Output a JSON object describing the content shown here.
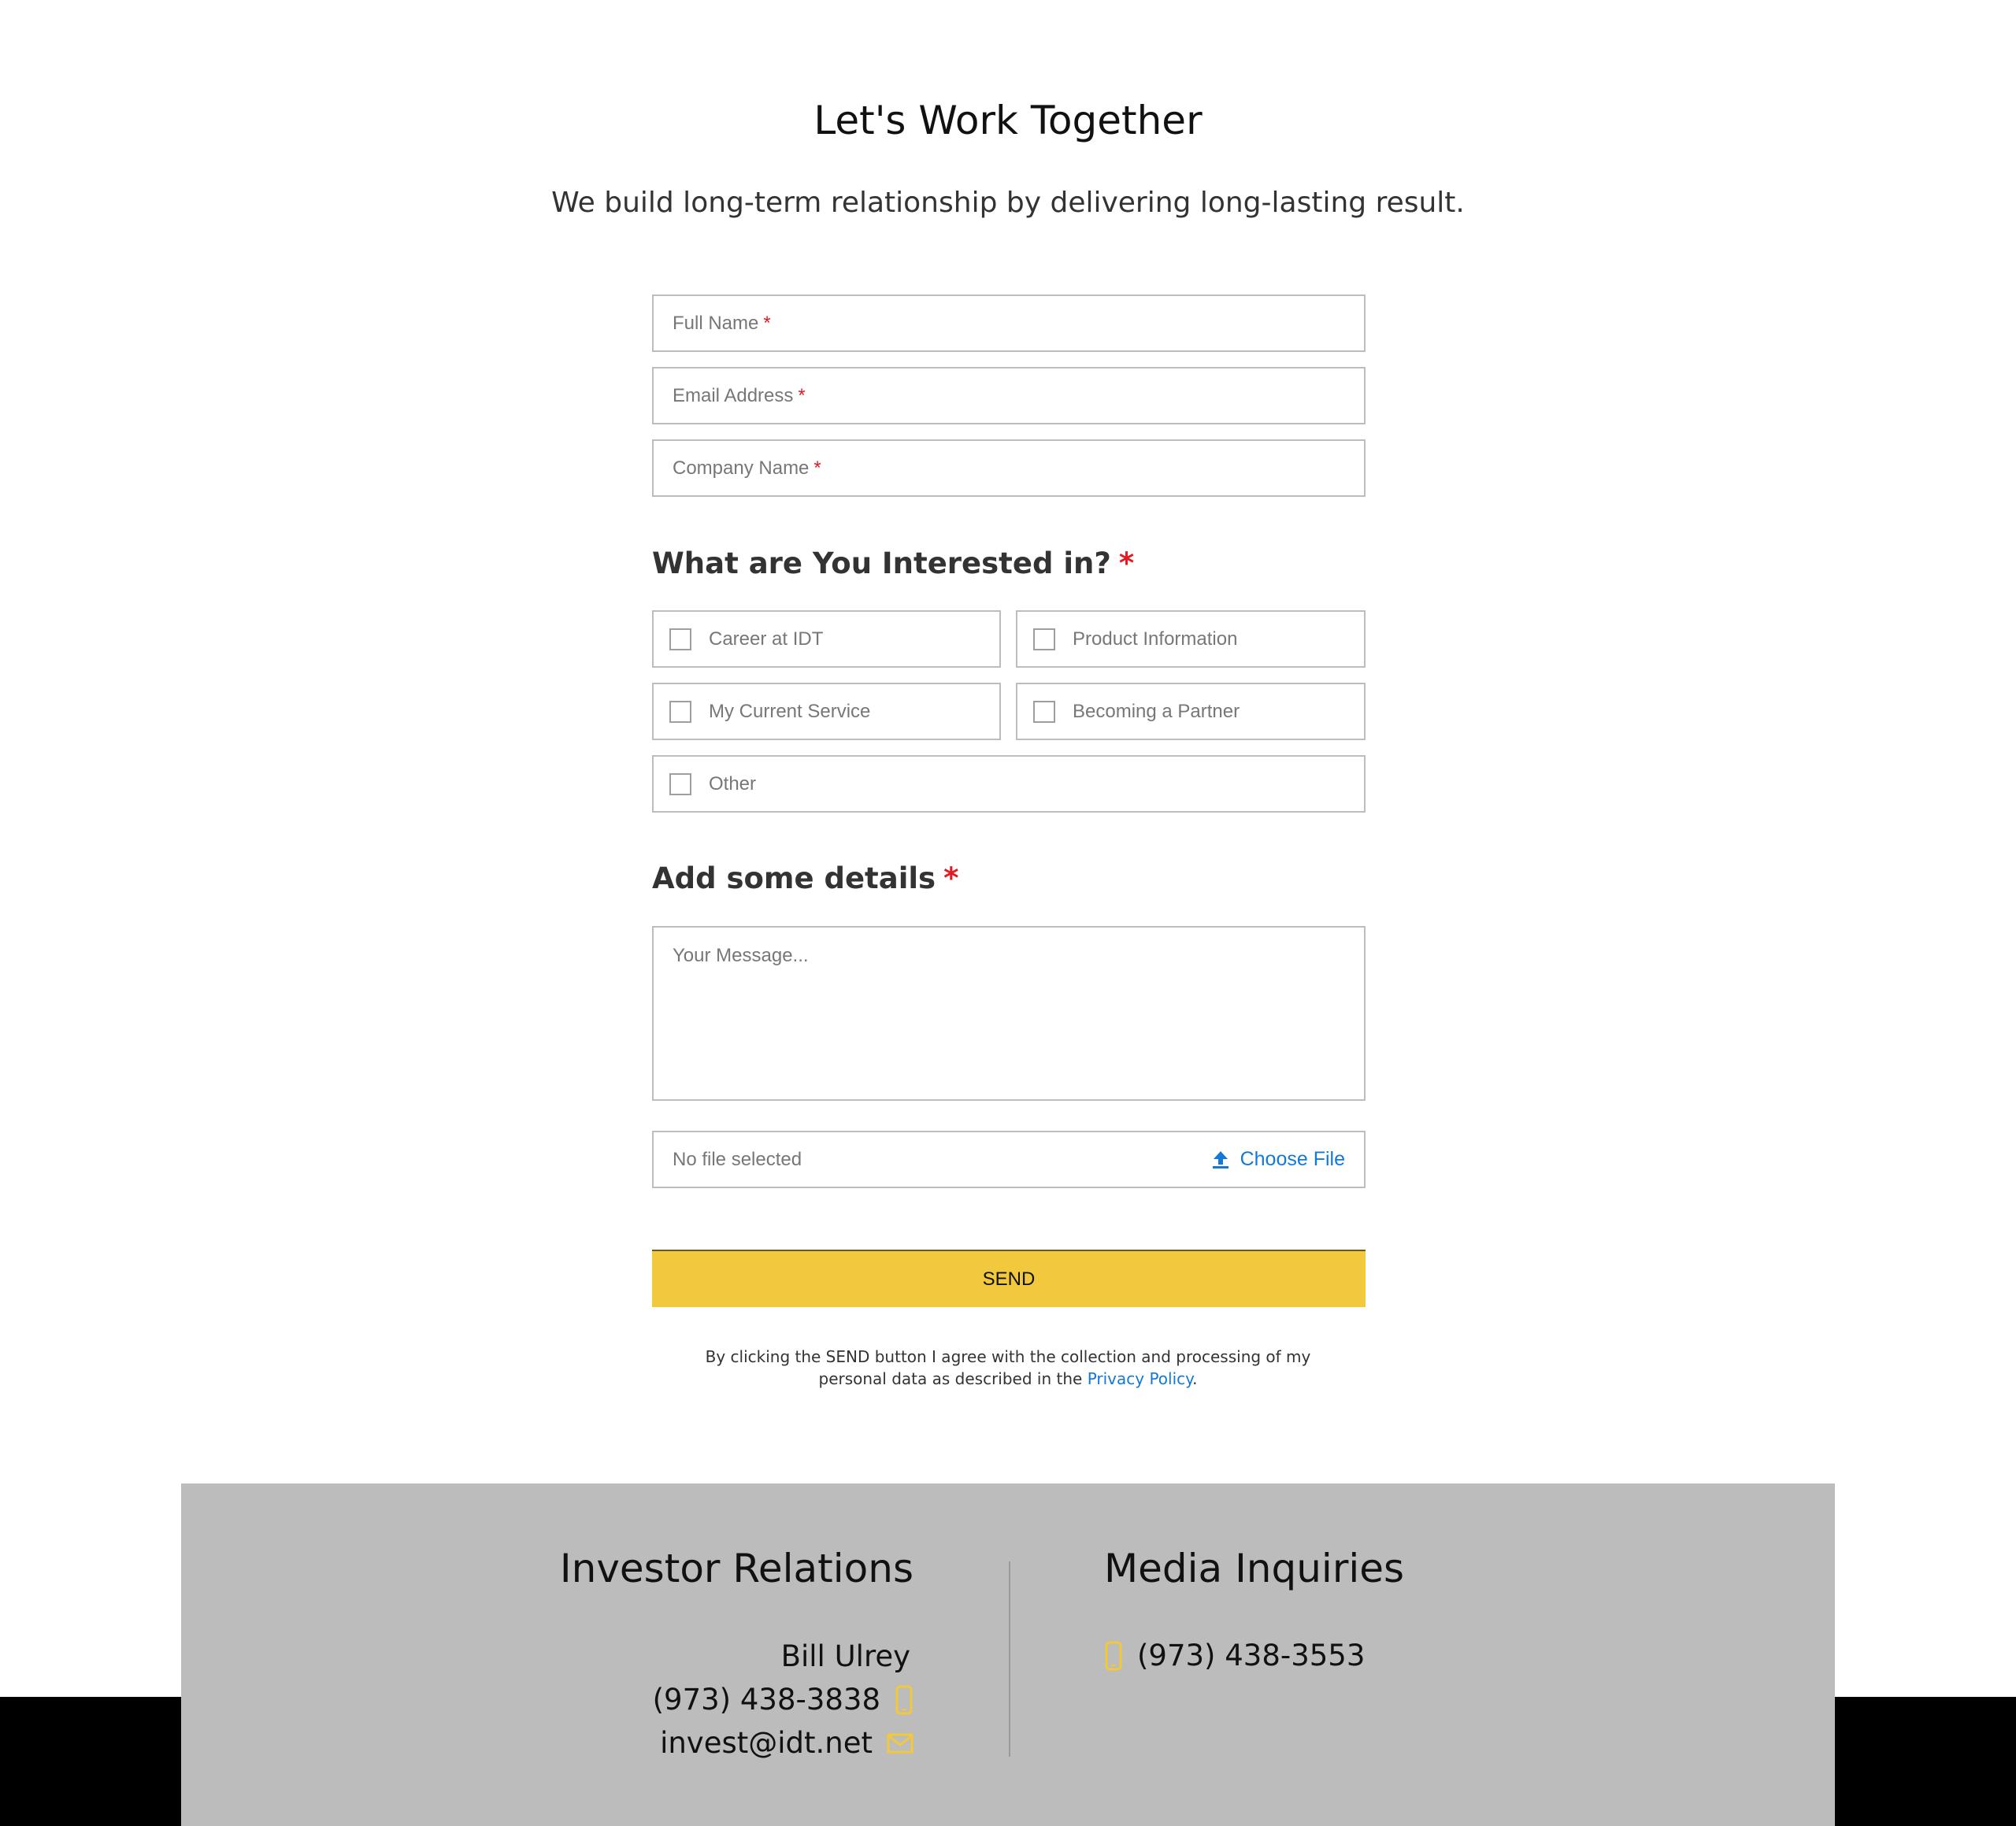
{
  "header": {
    "title": "Let's Work Together",
    "subtitle": "We build long-term relationship by delivering long-lasting result."
  },
  "form": {
    "required_mark": "*",
    "full_name_placeholder": "Full Name",
    "email_placeholder": "Email Address",
    "company_placeholder": "Company Name",
    "interests_heading": "What are You Interested in?",
    "interests": [
      {
        "label": "Career at IDT",
        "checked": false
      },
      {
        "label": "Product Information",
        "checked": false
      },
      {
        "label": "My Current Service",
        "checked": false
      },
      {
        "label": "Becoming a Partner",
        "checked": false
      },
      {
        "label": "Other",
        "checked": false
      }
    ],
    "details_heading": "Add some details",
    "message_placeholder": "Your Message...",
    "file_status": "No file selected",
    "choose_file_label": "Choose File",
    "send_label": "SEND",
    "consent_prefix": "By clicking the SEND button I agree with the collection and processing of my personal data as described in the ",
    "privacy_link": "Privacy Policy",
    "consent_suffix": "."
  },
  "footer": {
    "investor": {
      "title": "Investor Relations",
      "name": "Bill Ulrey",
      "phone": "(973) 438-3838",
      "email": "invest@idt.net",
      "phone_icon": "mobile-phone-icon",
      "email_icon": "envelope-icon"
    },
    "media": {
      "title": "Media Inquiries",
      "phone": "(973) 438-3553",
      "phone_icon": "mobile-phone-icon"
    }
  },
  "colors": {
    "accent_yellow": "#f2c93d",
    "link_blue": "#1478d8",
    "required_red": "#e01b22",
    "footer_gray": "#bcbcbc"
  }
}
